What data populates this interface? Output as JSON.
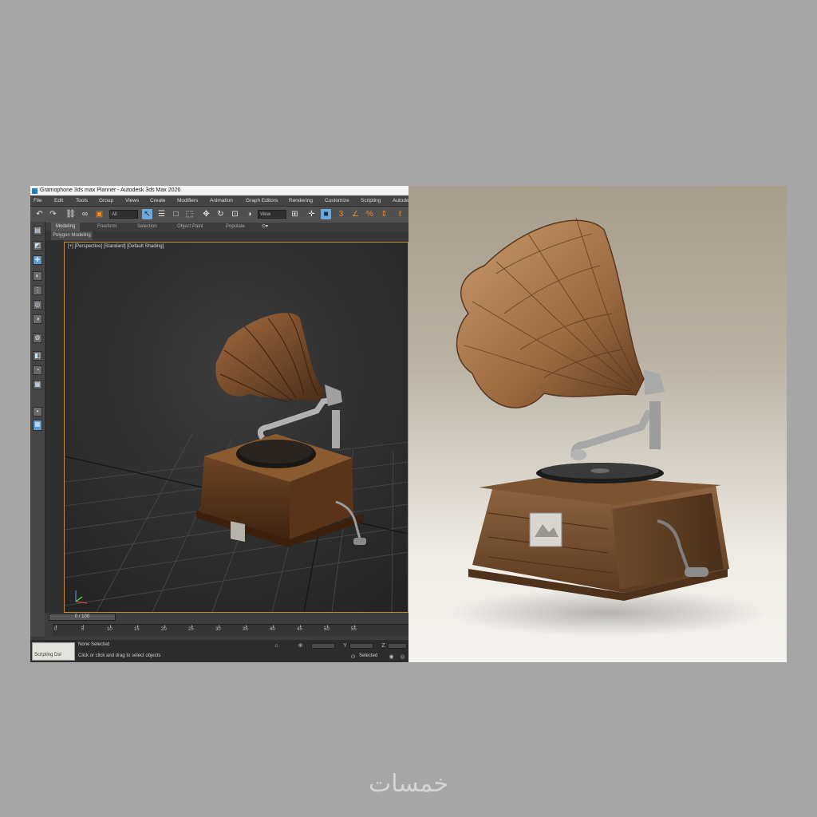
{
  "window": {
    "title": "Gramophone 3ds max Planner - Autodesk 3ds Max 2026"
  },
  "menu": {
    "items": [
      "File",
      "Edit",
      "Tools",
      "Group",
      "Views",
      "Create",
      "Modifiers",
      "Animation",
      "Graph Editors",
      "Rendering",
      "Customize",
      "Scripting",
      "Autodesk"
    ]
  },
  "toolbar": {
    "filter_value": "All",
    "view_value": "View"
  },
  "ribbon": {
    "tabs": [
      "Modeling",
      "Freeform",
      "Selection",
      "Object Paint",
      "Populate"
    ],
    "subpanel": "Polygon Modeling"
  },
  "viewport": {
    "label": "[+] [Perspective] [Standard] [Default Shading]"
  },
  "timeline": {
    "slider_label": "0 / 100",
    "ticks": [
      "0",
      "5",
      "10",
      "15",
      "20",
      "25",
      "30",
      "35",
      "40",
      "45",
      "50",
      "55"
    ]
  },
  "status": {
    "script_label": "Scripting Dsl",
    "selection": "None Selected",
    "prompt": "Click or click and drag to select objects",
    "right_label": "Selected"
  },
  "watermark": {
    "text": "خمسات"
  },
  "colors": {
    "accent": "#5f9ccc",
    "active_viewport_border": "#c58a2f",
    "wood": "#7a4f2c"
  }
}
